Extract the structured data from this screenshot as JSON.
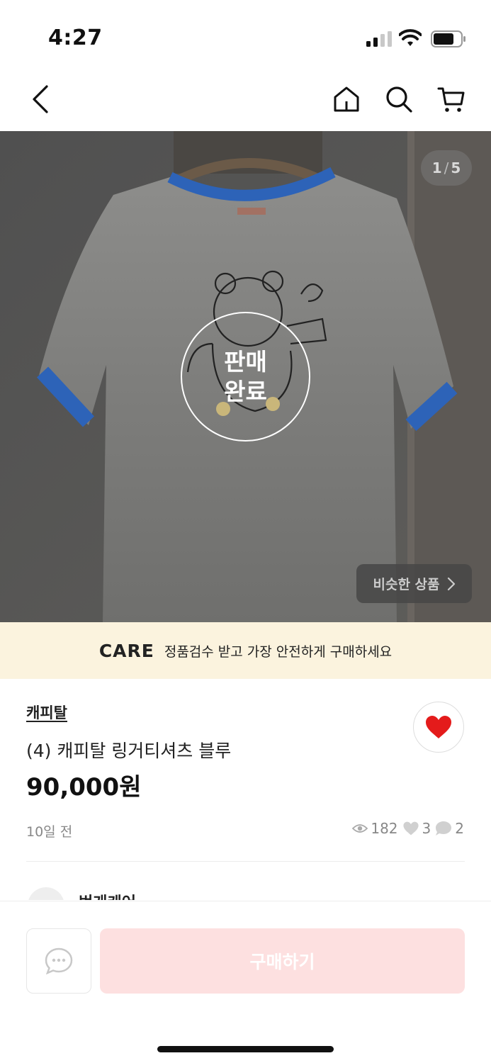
{
  "status": {
    "time": "4:27"
  },
  "nav": {
    "back_icon": "chevron-left-icon",
    "home_icon": "home-icon",
    "search_icon": "search-icon",
    "cart_icon": "cart-icon"
  },
  "gallery": {
    "current": "1",
    "separator": "/",
    "total": "5",
    "sold_line1": "판매",
    "sold_line2": "완료",
    "similar_label": "비슷한 상품"
  },
  "care": {
    "logo": "CARE",
    "text": "정품검수 받고 가장 안전하게 구매하세요"
  },
  "product": {
    "brand": "캐피탈",
    "title": "(4) 캐피탈 링거티셔츠 블루",
    "price": "90,000원",
    "posted": "10일 전",
    "liked": true,
    "views": "182",
    "likes": "3",
    "chats": "2"
  },
  "seller": {
    "name": "번개케어"
  },
  "bottom": {
    "buy_label": "구매하기"
  },
  "colors": {
    "heart": "#e41b1b",
    "care_bg": "#fbf3de",
    "buy_bg": "#fde0e0",
    "collar": "#2d63b8"
  }
}
